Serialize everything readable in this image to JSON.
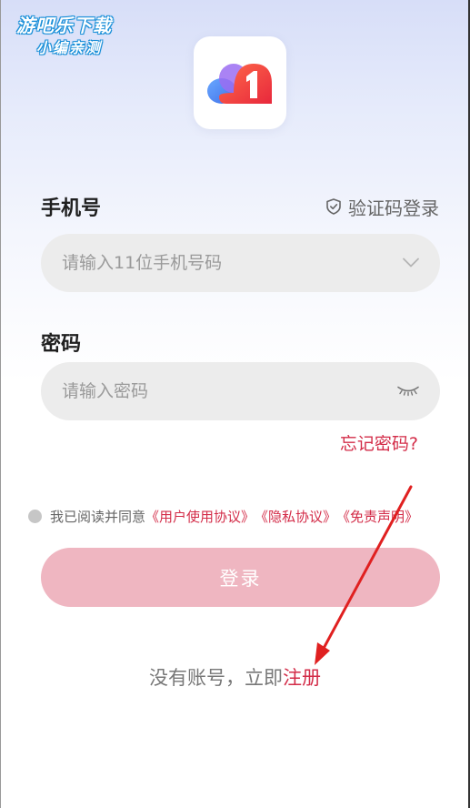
{
  "watermark": {
    "line1": "游吧乐下载",
    "line2": "小编亲测"
  },
  "logo": {
    "icon": "cloud-one-logo-icon"
  },
  "phone": {
    "label": "手机号",
    "sms_login_label": "验证码登录",
    "placeholder": "请输入11位手机号码",
    "value": "",
    "dropdown_icon": "chevron-down-icon"
  },
  "password": {
    "label": "密码",
    "placeholder": "请输入密码",
    "value": "",
    "visibility_icon": "eye-closed-icon"
  },
  "forgot_password": "忘记密码?",
  "agreement": {
    "prefix": "我已阅读并同意",
    "user_agreement": "《用户使用协议》",
    "privacy_agreement": "《隐私协议》",
    "disclaimer": "《免责声明》",
    "checked": false
  },
  "login_button": "登录",
  "register": {
    "prefix": "没有账号，立即",
    "link": "注册"
  },
  "colors": {
    "accent_red": "#d32c48",
    "login_button_bg": "#efb6c1",
    "field_bg": "#ececec",
    "annotation_arrow": "#e02020"
  }
}
